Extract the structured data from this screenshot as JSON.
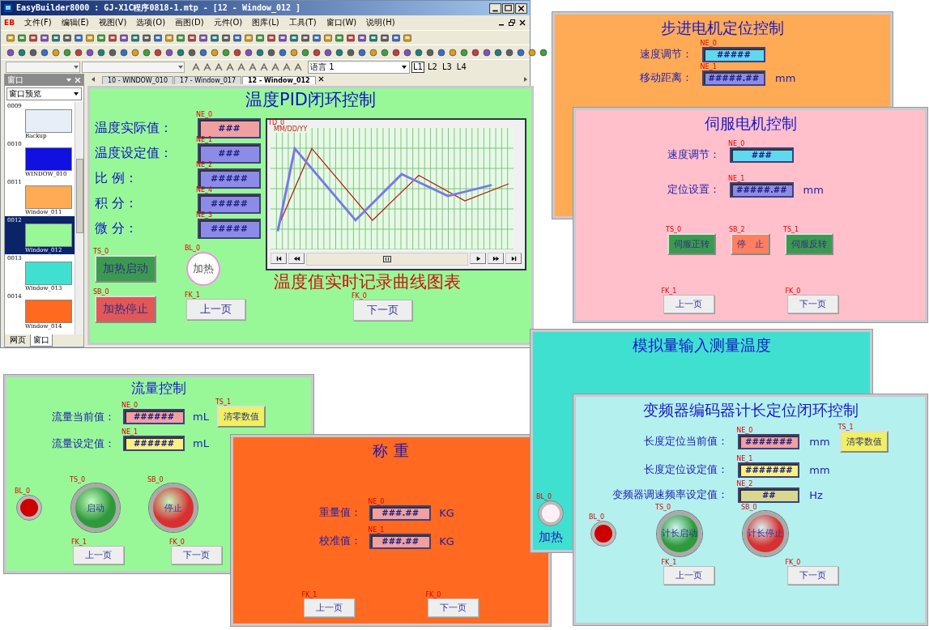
{
  "editor": {
    "title": "EasyBuilder8000 : GJ-X1C程序0818-1.mtp - [12 - Window_012 ]",
    "logo": "EB",
    "menu": [
      "文件(F)",
      "编辑(E)",
      "视图(V)",
      "选项(O)",
      "画图(D)",
      "元件(O)",
      "图库(L)",
      "工具(T)",
      "窗口(W)",
      "说明(H)"
    ],
    "language": "语言 1",
    "layers": [
      {
        "label": "L1",
        "selected": true
      },
      {
        "label": "L2",
        "selected": false
      },
      {
        "label": "L3",
        "selected": false
      },
      {
        "label": "L4",
        "selected": false
      }
    ],
    "tabs": [
      {
        "label": "10 - WINDOW_010",
        "selected": false
      },
      {
        "label": "17 - Window_017",
        "selected": false
      },
      {
        "label": "12 - Window_012",
        "selected": true
      }
    ],
    "sidebar": {
      "title": "窗口",
      "view_select": "窗口预览",
      "items": [
        {
          "number": "0009",
          "name": "Backup",
          "selected": false,
          "color": "#e8eef8"
        },
        {
          "number": "0010",
          "name": "WINDOW_010",
          "selected": false,
          "color": "#1010e0"
        },
        {
          "number": "0011",
          "name": "Window_011",
          "selected": false,
          "color": "#ffaa55"
        },
        {
          "number": "0012",
          "name": "Window_012",
          "selected": true,
          "color": "#98f898"
        },
        {
          "number": "0013",
          "name": "Window_013",
          "selected": false,
          "color": "#40e0d0"
        },
        {
          "number": "0014",
          "name": "Window_014",
          "selected": false,
          "color": "#ff6a20"
        }
      ],
      "tabs": [
        {
          "label": "网页",
          "selected": false
        },
        {
          "label": "窗口",
          "selected": true
        }
      ]
    },
    "canvas": {
      "title": "温度PID闭环控制",
      "fields": [
        {
          "label": "温度实际值：",
          "tag": "NE_0",
          "value": "###",
          "color": "#f0a0a0"
        },
        {
          "label": "温度设定值：",
          "tag": "NE_1",
          "value": "###",
          "color": "#8c8ce8"
        },
        {
          "label": "比 例：",
          "tag": "NE_2",
          "value": "#####",
          "color": "#8c8ce8"
        },
        {
          "label": "积 分：",
          "tag": "NE_4",
          "value": "#####",
          "color": "#8c8ce8"
        },
        {
          "label": "微 分：",
          "tag": "NE_3",
          "value": "#####",
          "color": "#8c8ce8"
        }
      ],
      "buttons": [
        {
          "tag": "TS_0",
          "label": "加热启动",
          "color": "#3c9a50"
        },
        {
          "tag": "SB_0",
          "label": "加热停止",
          "color": "#e05858"
        }
      ],
      "lamp": {
        "tag": "BL_0",
        "label": "加热"
      },
      "chart": {
        "tag": "TD_0",
        "date_format": "MM/DD/YY"
      },
      "caption": "温度值实时记录曲线图表",
      "nav": [
        {
          "tag": "FK_1",
          "label": "上一页"
        },
        {
          "tag": "FK_0",
          "label": "下一页"
        }
      ]
    }
  },
  "panels": [
    {
      "title": "步进电机定位控制",
      "color": "#ffaa55",
      "fields": [
        {
          "label": "速度调节：",
          "tag": "NE_0",
          "value": "#####",
          "color": "#60d8f0"
        },
        {
          "label": "移动距离：",
          "tag": "NE_1",
          "value": "#####.##",
          "unit": "mm",
          "color": "#8c8ce8"
        }
      ]
    },
    {
      "title": "伺服电机控制",
      "color": "#ffc0cb",
      "fields": [
        {
          "label": "速度调节：",
          "tag": "NE_0",
          "value": "###",
          "color": "#60d8f0"
        },
        {
          "label": "定位设置：",
          "tag": "NE_1",
          "value": "#####.##",
          "unit": "mm",
          "color": "#8c8ce8"
        }
      ],
      "controls": [
        {
          "kind": "rect",
          "tag": "TS_0",
          "label": "伺服正转",
          "color": "#3c9a50"
        },
        {
          "kind": "rect",
          "tag": "SB_2",
          "label": "停　止",
          "color": "#ff7f60"
        },
        {
          "kind": "rect",
          "tag": "TS_1",
          "label": "伺服反转",
          "color": "#3c9a50"
        }
      ],
      "nav": [
        {
          "tag": "FK_1",
          "label": "上一页"
        },
        {
          "tag": "FK_0",
          "label": "下一页"
        }
      ]
    },
    {
      "title": "流量控制",
      "color": "#98f898",
      "fields": [
        {
          "label": "流量当前值：",
          "tag": "NE_0",
          "value": "######",
          "unit": "mL",
          "color": "#f0a0a0",
          "button": {
            "tag": "TS_1",
            "label": "清零数值"
          }
        },
        {
          "label": "流量设定值：",
          "tag": "NE_1",
          "value": "######",
          "unit": "mL",
          "color": "#f8f080"
        }
      ],
      "controls": [
        {
          "kind": "lamp",
          "tag": "BL_0",
          "color": "#cc0000"
        },
        {
          "kind": "round",
          "tag": "TS_0",
          "label": "启动",
          "color": "#2e9a3a"
        },
        {
          "kind": "round",
          "tag": "SB_0",
          "label": "停止",
          "color": "#d83030"
        }
      ],
      "nav": [
        {
          "tag": "FK_1",
          "label": "上一页"
        },
        {
          "tag": "FK_0",
          "label": "下一页"
        }
      ]
    },
    {
      "title": "称 重",
      "color": "#ff6a20",
      "fields": [
        {
          "label": "重量值：",
          "tag": "NE_0",
          "value": "###.##",
          "unit": "KG",
          "color": "#f0a0a0"
        },
        {
          "label": "校准值：",
          "tag": "NE_1",
          "value": "###.##",
          "unit": "KG",
          "color": "#f0a0a0"
        }
      ],
      "nav": [
        {
          "tag": "FK_1",
          "label": "上一页"
        },
        {
          "tag": "FK_0",
          "label": "下一页"
        }
      ]
    },
    {
      "title": "模拟量输入测量温度",
      "color": "#40e0d0",
      "controls": [
        {
          "kind": "lamp",
          "tag": "BL_0",
          "label": "加热",
          "color": "#fff0f8"
        }
      ]
    },
    {
      "title": "变频器编码器计长定位闭环控制",
      "color": "#b4f0ee",
      "fields": [
        {
          "label": "长度定位当前值：",
          "tag": "NE_0",
          "value": "#######",
          "unit": "mm",
          "color": "#f0a0a0",
          "button": {
            "tag": "TS_1",
            "label": "清零数值"
          }
        },
        {
          "label": "长度定位设定值：",
          "tag": "NE_1",
          "value": "#######",
          "unit": "mm",
          "color": "#f8f080"
        },
        {
          "label": "变频器调速频率设定值：",
          "tag": "NE_2",
          "value": "##",
          "unit": "Hz",
          "color": "#d8d890"
        }
      ],
      "controls": [
        {
          "kind": "lamp",
          "tag": "BL_0",
          "color": "#cc0000"
        },
        {
          "kind": "round",
          "tag": "TS_0",
          "label": "计长启动",
          "color": "#2e9a3a"
        },
        {
          "kind": "round",
          "tag": "SB_0",
          "label": "计长停止",
          "color": "#d83030"
        }
      ],
      "nav": [
        {
          "tag": "FK_1",
          "label": "上一页"
        },
        {
          "tag": "FK_0",
          "label": "下一页"
        }
      ]
    }
  ]
}
